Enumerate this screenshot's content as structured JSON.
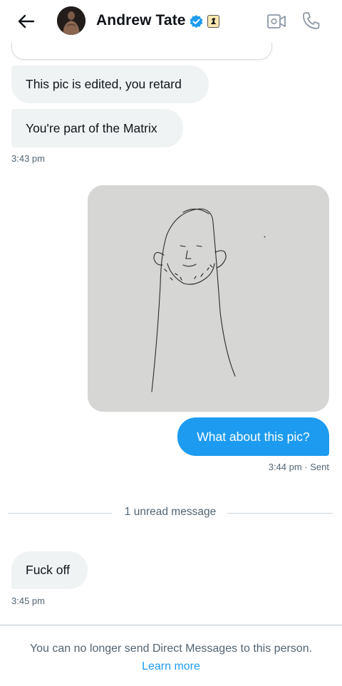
{
  "header": {
    "title": "Andrew Tate",
    "icons": [
      "back-arrow-icon",
      "avatar",
      "verified-badge-icon",
      "affiliate-badge-icon",
      "video-call-icon",
      "phone-call-icon"
    ],
    "verified_color": "#1d9bf0"
  },
  "messages": {
    "received_1": "This pic is edited, you retard",
    "received_2": "You're part of the Matrix",
    "time_1": "3:43 pm",
    "sent_1": "What about this pic?",
    "time_sent": "3:44 pm · Sent",
    "received_3": "Fuck off",
    "time_3": "3:45 pm"
  },
  "divider": {
    "label": "1 unread message"
  },
  "footer": {
    "notice": "You can no longer send Direct Messages to this person.",
    "link": "Learn more"
  },
  "colors": {
    "accent": "#1d9bf0",
    "bubble_in": "#eff3f4",
    "muted_text": "#536471"
  }
}
